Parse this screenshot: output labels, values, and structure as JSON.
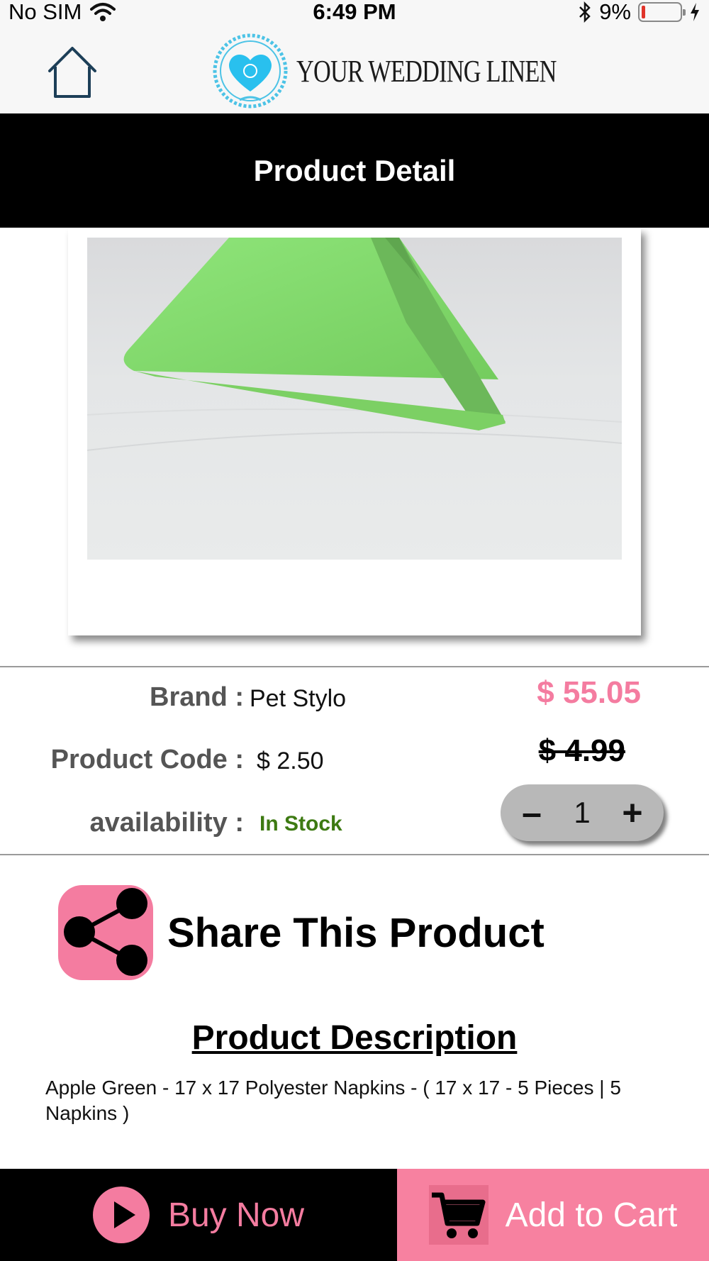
{
  "status_bar": {
    "carrier": "No SIM",
    "time": "6:49 PM",
    "battery": "9%",
    "battery_level": 0.09
  },
  "header": {
    "logo_text": "YOUR WEDDING LINEN"
  },
  "title": "Product Detail",
  "product": {
    "brand_label": "Brand :",
    "brand": "Pet Stylo",
    "code_label": "Product Code :",
    "code": "$ 2.50",
    "availability_label": "availability :",
    "availability": "In Stock",
    "price": "$ 55.05",
    "old_price": "$ 4.99",
    "quantity": "1"
  },
  "quantity": {
    "minus": "–",
    "plus": "+"
  },
  "share": {
    "label": "Share This Product"
  },
  "description": {
    "title": "Product Description",
    "body": "Apple Green - 17 x 17 Polyester Napkins - ( 17 x 17 - 5 Pieces | 5 Napkins )"
  },
  "actions": {
    "buy_now": "Buy Now",
    "add_to_cart": "Add to Cart"
  },
  "colors": {
    "accent_pink": "#f47ca0",
    "in_stock_green": "#3d7a12",
    "bar_black": "#000000"
  }
}
